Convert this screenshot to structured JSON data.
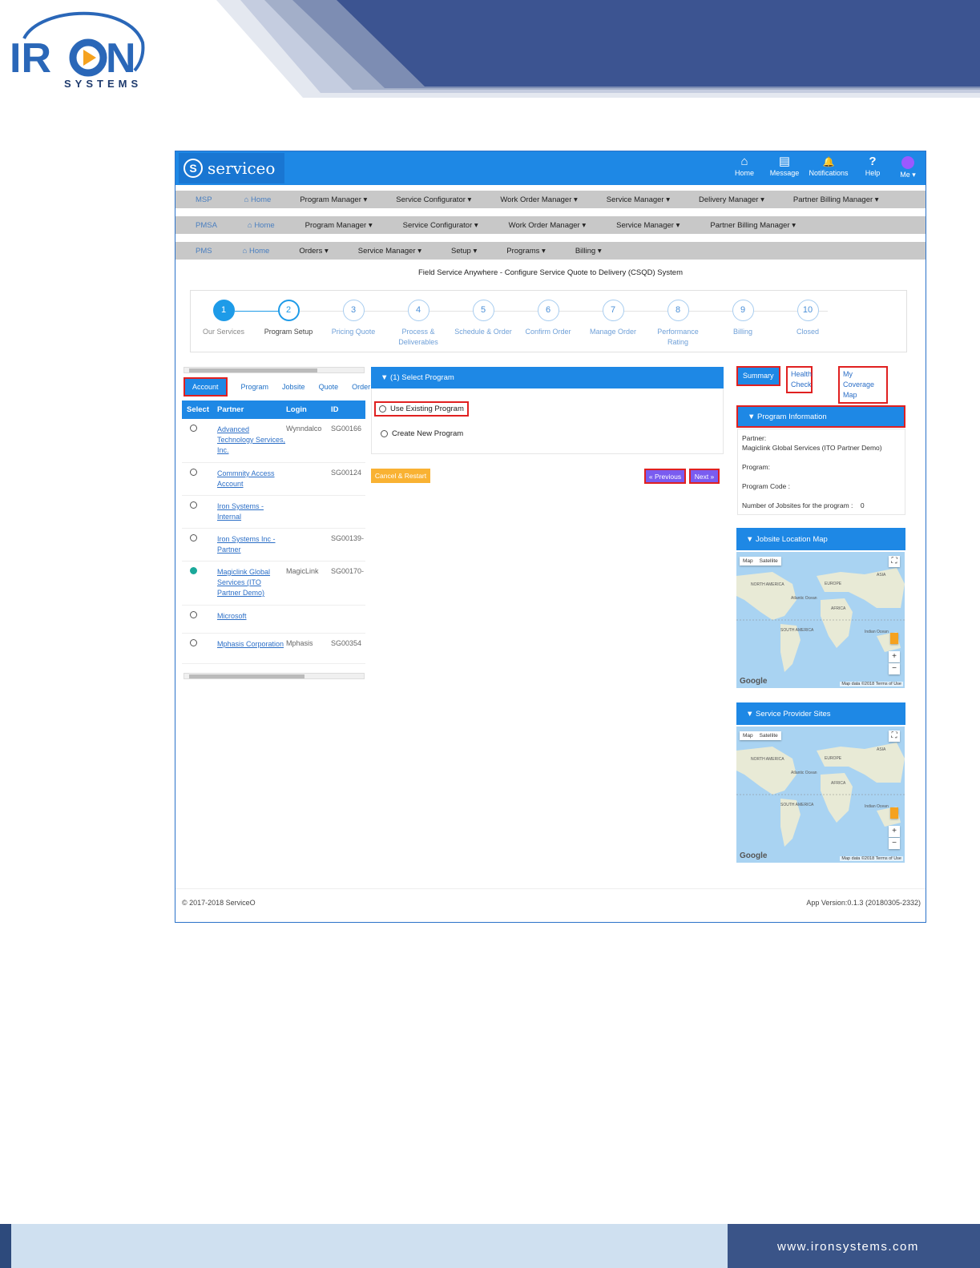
{
  "brand": {
    "logo_text": "SYSTEMS",
    "footer_url": "www.ironsystems.com"
  },
  "app": {
    "name": "serviceo",
    "top_icons": [
      {
        "icon": "home-icon",
        "glyph": "⌂",
        "label": "Home"
      },
      {
        "icon": "message-icon",
        "glyph": "▤",
        "label": "Message"
      },
      {
        "icon": "bell-icon",
        "glyph": "🔔",
        "label": "Notifications"
      },
      {
        "icon": "help-icon",
        "glyph": "?",
        "label": "Help"
      }
    ],
    "me_label": "Me ▾",
    "menus": [
      {
        "code": "MSP",
        "home": "⌂ Home",
        "items": [
          "Program Manager ▾",
          "Service Configurator ▾",
          "Work Order Manager ▾",
          "Service Manager ▾",
          "Delivery Manager ▾",
          "Partner Billing Manager ▾"
        ]
      },
      {
        "code": "PMSA",
        "home": "⌂ Home",
        "items": [
          "Program Manager ▾",
          "Service Configurator ▾",
          "Work Order Manager ▾",
          "Service Manager ▾",
          "Partner Billing Manager ▾"
        ]
      },
      {
        "code": "PMS",
        "home": "⌂ Home",
        "items": [
          "Orders ▾",
          "Service Manager ▾",
          "Setup ▾",
          "Programs ▾",
          "Billing ▾"
        ]
      }
    ],
    "subtitle": "Field Service Anywhere - Configure Service Quote to Delivery (CSQD) System",
    "steps": [
      {
        "num": "1",
        "label": "Our Services",
        "state": "done"
      },
      {
        "num": "2",
        "label": "Program Setup",
        "state": "active"
      },
      {
        "num": "3",
        "label": "Pricing Quote",
        "state": ""
      },
      {
        "num": "4",
        "label": "Process & Deliverables",
        "state": ""
      },
      {
        "num": "5",
        "label": "Schedule & Order",
        "state": ""
      },
      {
        "num": "6",
        "label": "Confirm Order",
        "state": ""
      },
      {
        "num": "7",
        "label": "Manage Order",
        "state": ""
      },
      {
        "num": "8",
        "label": "Performance Rating",
        "state": ""
      },
      {
        "num": "9",
        "label": "Billing",
        "state": ""
      },
      {
        "num": "10",
        "label": "Closed",
        "state": ""
      }
    ],
    "left_tabs": [
      "Account",
      "Program",
      "Jobsite",
      "Quote",
      "Order"
    ],
    "table": {
      "headers": [
        "Select",
        "Partner",
        "Login",
        "ID"
      ],
      "rows": [
        {
          "selected": false,
          "partner": "Advanced Technology Services, Inc.",
          "login": "Wynndalco",
          "id": "SG00166"
        },
        {
          "selected": false,
          "partner": "Commnity Access Account",
          "login": "",
          "id": "SG00124"
        },
        {
          "selected": false,
          "partner": "Iron Systems - Internal",
          "login": "",
          "id": ""
        },
        {
          "selected": false,
          "partner": "Iron Systems Inc - Partner",
          "login": "",
          "id": "SG00139-"
        },
        {
          "selected": true,
          "partner": "Magiclink Global Services (ITO Partner Demo)",
          "login": "MagicLink",
          "id": "SG00170-"
        },
        {
          "selected": false,
          "partner": "Microsoft",
          "login": "",
          "id": ""
        },
        {
          "selected": false,
          "partner": "Mphasis Corporation",
          "login": "Mphasis",
          "id": "SG00354"
        }
      ]
    },
    "middle": {
      "header": "▼  (1) Select Program",
      "opt_existing": "Use Existing Program",
      "opt_new": "Create New Program",
      "cancel": "Cancel & Restart",
      "previous": "« Previous",
      "next": "Next »"
    },
    "right": {
      "summary": "Summary",
      "health": "Health Check",
      "coverage": "My Coverage Map",
      "info_header": "▼   Program Information",
      "partner_label": "Partner:",
      "partner_value": "Magiclink Global Services (ITO Partner Demo)",
      "program_label": "Program:",
      "code_label": "Program Code :",
      "jobsites_label": "Number of Jobsites for the program :",
      "jobsites_value": "0",
      "map1_header": "▼   Jobsite Location Map",
      "map2_header": "▼   Service Provider Sites",
      "map_tab_map": "Map",
      "map_tab_sat": "Satellite",
      "google": "Google",
      "map_data": "Map data ©2018   Terms of Use",
      "continents": [
        "NORTH AMERICA",
        "EUROPE",
        "ASIA",
        "AFRICA",
        "SOUTH AMERICA",
        "Atlantic Ocean",
        "Indian Ocean"
      ]
    },
    "footer_left": "© 2017-2018 ServiceO",
    "footer_right": "App Version:0.1.3 (20180305-2332)"
  }
}
